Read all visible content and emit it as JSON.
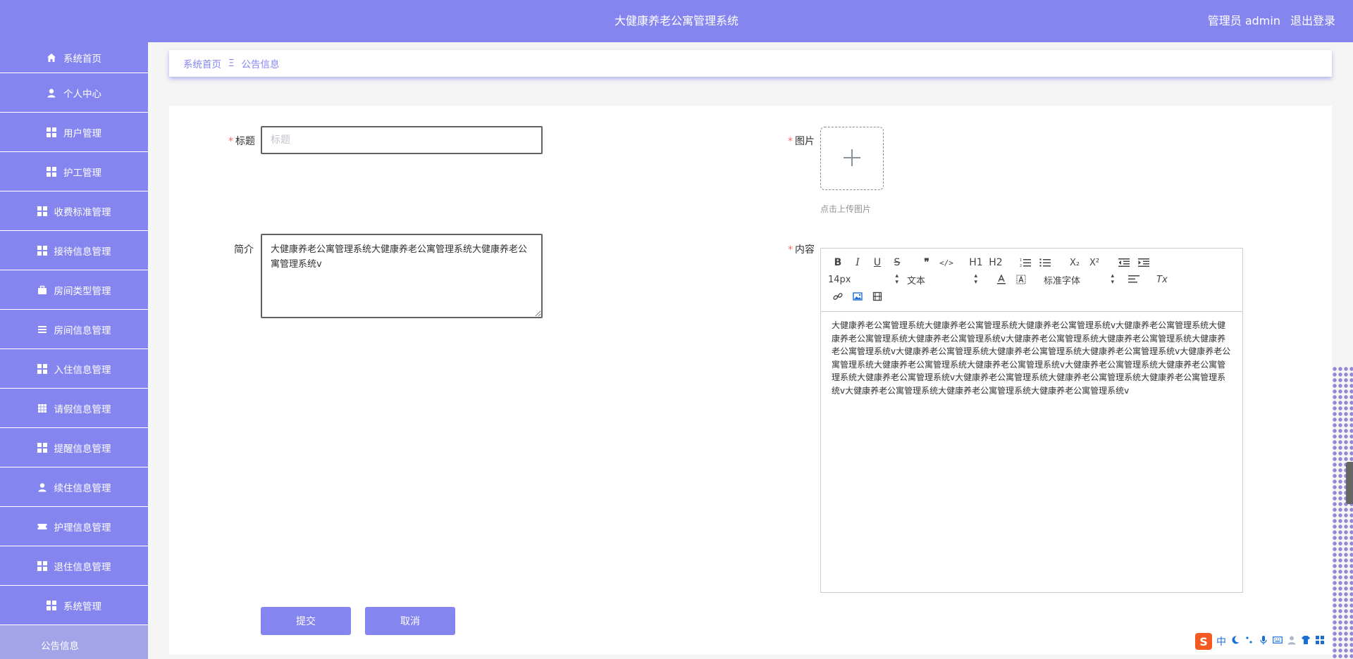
{
  "header": {
    "title": "大健康养老公寓管理系统",
    "user_label": "管理员 admin",
    "logout_label": "退出登录"
  },
  "sidebar": {
    "items": [
      {
        "label": "系统首页",
        "icon": "home-icon"
      },
      {
        "label": "个人中心",
        "icon": "user-icon"
      },
      {
        "label": "用户管理",
        "icon": "grid-icon"
      },
      {
        "label": "护工管理",
        "icon": "grid-icon"
      },
      {
        "label": "收费标准管理",
        "icon": "grid-icon"
      },
      {
        "label": "接待信息管理",
        "icon": "grid-icon"
      },
      {
        "label": "房间类型管理",
        "icon": "briefcase-icon"
      },
      {
        "label": "房间信息管理",
        "icon": "list-icon"
      },
      {
        "label": "入住信息管理",
        "icon": "grid-icon"
      },
      {
        "label": "请假信息管理",
        "icon": "table-icon"
      },
      {
        "label": "提醒信息管理",
        "icon": "grid-icon"
      },
      {
        "label": "续住信息管理",
        "icon": "user-icon"
      },
      {
        "label": "护理信息管理",
        "icon": "ticket-icon"
      },
      {
        "label": "退住信息管理",
        "icon": "grid-icon"
      },
      {
        "label": "系统管理",
        "icon": "grid-icon"
      }
    ],
    "active_sub": "公告信息"
  },
  "breadcrumb": {
    "home": "系统首页",
    "separator": "Ξ",
    "current": "公告信息"
  },
  "form": {
    "title_label": "标题",
    "title_placeholder": "标题",
    "title_value": "",
    "image_label": "图片",
    "upload_tip": "点击上传图片",
    "intro_label": "简介",
    "intro_value": "大健康养老公寓管理系统大健康养老公寓管理系统大健康养老公寓管理系统v",
    "content_label": "内容",
    "content_value": "大健康养老公寓管理系统大健康养老公寓管理系统大健康养老公寓管理系统v大健康养老公寓管理系统大健康养老公寓管理系统大健康养老公寓管理系统v大健康养老公寓管理系统大健康养老公寓管理系统大健康养老公寓管理系统v大健康养老公寓管理系统大健康养老公寓管理系统大健康养老公寓管理系统v大健康养老公寓管理系统大健康养老公寓管理系统大健康养老公寓管理系统v大健康养老公寓管理系统大健康养老公寓管理系统大健康养老公寓管理系统v大健康养老公寓管理系统大健康养老公寓管理系统大健康养老公寓管理系统v大健康养老公寓管理系统大健康养老公寓管理系统大健康养老公寓管理系统v",
    "submit_label": "提交",
    "cancel_label": "取消"
  },
  "editor_toolbar": {
    "font_size": "14px",
    "header_select": "文本",
    "font_family": "标准字体",
    "bold": "B",
    "italic": "I",
    "underline": "U",
    "strike": "S",
    "blockquote": "❞",
    "code": "</>",
    "h1": "H1",
    "h2": "H2",
    "sub": "X₂",
    "sup": "X²",
    "clear": "Tx"
  },
  "ime": {
    "label": "中"
  },
  "colors": {
    "brand": "#8585f0",
    "required": "#f56c6c"
  }
}
